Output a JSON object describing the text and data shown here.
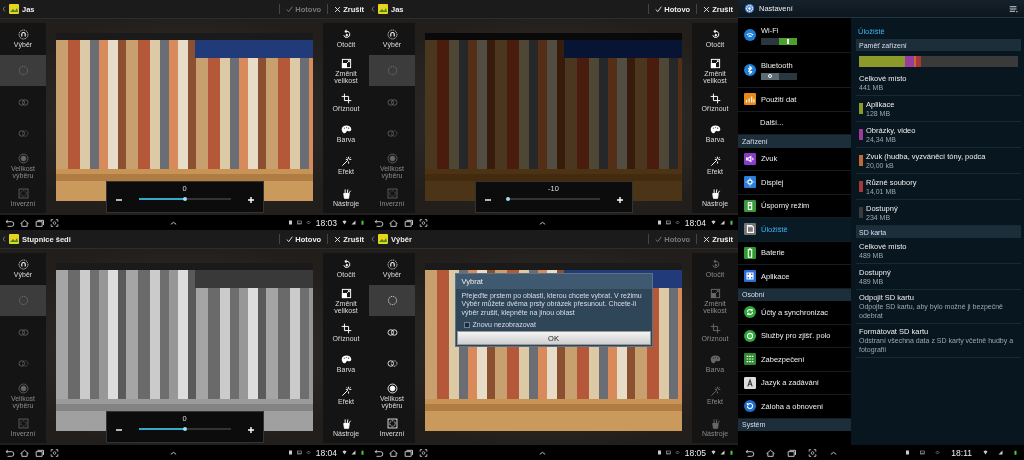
{
  "editors": [
    {
      "title": "Jas",
      "done": "Hotovo",
      "done_enabled": false,
      "cancel": "Zrušit",
      "darkened": false,
      "grayscale": false,
      "slider": {
        "value": "0",
        "level": 0.5
      },
      "left_tools": [
        {
          "kind": "lasso",
          "label": "Výběr",
          "selected": false,
          "disabled": false
        },
        {
          "kind": "circle",
          "selected": true,
          "disabled": true
        },
        {
          "kind": "union",
          "selected": false,
          "disabled": true
        },
        {
          "kind": "intersect",
          "selected": false,
          "disabled": true
        },
        {
          "kind": "size",
          "label": "Velikost výběru",
          "selected": false,
          "disabled": true
        },
        {
          "kind": "invert",
          "label": "Inverzní",
          "selected": false,
          "disabled": true
        }
      ],
      "right_tools": [
        {
          "kind": "rotate",
          "label": "Otočit",
          "disabled": false
        },
        {
          "kind": "resize",
          "label": "Změnit velikost",
          "disabled": false
        },
        {
          "kind": "crop",
          "label": "Oříznout",
          "disabled": false
        },
        {
          "kind": "palette",
          "label": "Barva",
          "disabled": false
        },
        {
          "kind": "wand",
          "label": "Efekt",
          "disabled": false
        },
        {
          "kind": "tools",
          "label": "Nástroje",
          "disabled": false
        }
      ],
      "time": "18:03"
    },
    {
      "title": "Jas",
      "done": "Hotovo",
      "done_enabled": true,
      "cancel": "Zrušit",
      "darkened": true,
      "grayscale": false,
      "slider": {
        "value": "-10",
        "level": 0.0
      },
      "left_tools": [
        {
          "kind": "lasso",
          "label": "Výběr",
          "selected": false,
          "disabled": false
        },
        {
          "kind": "circle",
          "selected": true,
          "disabled": true
        },
        {
          "kind": "union",
          "selected": false,
          "disabled": true
        },
        {
          "kind": "intersect",
          "selected": false,
          "disabled": true
        },
        {
          "kind": "size",
          "label": "Velikost výběru",
          "selected": false,
          "disabled": true
        },
        {
          "kind": "invert",
          "label": "Inverzní",
          "selected": false,
          "disabled": true
        }
      ],
      "right_tools": [
        {
          "kind": "rotate",
          "label": "Otočit",
          "disabled": false
        },
        {
          "kind": "resize",
          "label": "Změnit velikost",
          "disabled": false
        },
        {
          "kind": "crop",
          "label": "Oříznout",
          "disabled": false
        },
        {
          "kind": "palette",
          "label": "Barva",
          "disabled": false
        },
        {
          "kind": "wand",
          "label": "Efekt",
          "disabled": false
        },
        {
          "kind": "tools",
          "label": "Nástroje",
          "disabled": false
        }
      ],
      "time": "18:04"
    },
    {
      "title": "Stupnice šedi",
      "done": "Hotovo",
      "done_enabled": true,
      "cancel": "Zrušit",
      "darkened": false,
      "grayscale": true,
      "slider": {
        "value": "0",
        "level": 0.5
      },
      "left_tools": [
        {
          "kind": "lasso",
          "label": "Výběr",
          "selected": false,
          "disabled": false
        },
        {
          "kind": "circle",
          "selected": true,
          "disabled": true
        },
        {
          "kind": "union",
          "selected": false,
          "disabled": true
        },
        {
          "kind": "intersect",
          "selected": false,
          "disabled": true
        },
        {
          "kind": "size",
          "label": "Velikost výběru",
          "selected": false,
          "disabled": true
        },
        {
          "kind": "invert",
          "label": "Inverzní",
          "selected": false,
          "disabled": true
        }
      ],
      "right_tools": [
        {
          "kind": "rotate",
          "label": "Otočit",
          "disabled": false
        },
        {
          "kind": "resize",
          "label": "Změnit velikost",
          "disabled": false
        },
        {
          "kind": "crop",
          "label": "Oříznout",
          "disabled": false
        },
        {
          "kind": "palette",
          "label": "Barva",
          "disabled": false
        },
        {
          "kind": "wand",
          "label": "Efekt",
          "disabled": false
        },
        {
          "kind": "tools",
          "label": "Nástroje",
          "disabled": false
        }
      ],
      "time": "18:04"
    },
    {
      "title": "Výběr",
      "done": "Hotovo",
      "done_enabled": false,
      "cancel": "Zrušit",
      "darkened": false,
      "grayscale": false,
      "dialog": {
        "title": "Vybrat",
        "message": "Přejeďte prstem po oblasti, kterou chcete vybrat. V režimu Výběr můžete dvěma prsty obrázek přesunout. Chcete-li výběr zrušit, klepněte na jinou oblast",
        "checkbox": "Znovu nezobrazovat",
        "checked": false,
        "button": "OK"
      },
      "left_tools": [
        {
          "kind": "lasso",
          "label": "Výběr",
          "selected": false,
          "disabled": false
        },
        {
          "kind": "circle",
          "selected": true,
          "disabled": false
        },
        {
          "kind": "union",
          "selected": false,
          "disabled": false
        },
        {
          "kind": "intersect",
          "selected": false,
          "disabled": false
        },
        {
          "kind": "size",
          "label": "Velikost výběru",
          "selected": false,
          "disabled": false
        },
        {
          "kind": "invert",
          "label": "Inverzní",
          "selected": false,
          "disabled": false
        }
      ],
      "right_tools": [
        {
          "kind": "rotate",
          "label": "Otočit",
          "disabled": true
        },
        {
          "kind": "resize",
          "label": "Změnit velikost",
          "disabled": true
        },
        {
          "kind": "crop",
          "label": "Oříznout",
          "disabled": true
        },
        {
          "kind": "palette",
          "label": "Barva",
          "disabled": true
        },
        {
          "kind": "wand",
          "label": "Efekt",
          "disabled": true
        },
        {
          "kind": "tools",
          "label": "Nástroje",
          "disabled": true
        }
      ],
      "time": "18:05"
    }
  ],
  "settings": {
    "title": "Nastavení",
    "time": "18:11",
    "menu": [
      {
        "kind": "toggle",
        "label": "Wi-Fi",
        "on": true
      },
      {
        "kind": "toggle",
        "label": "Bluetooth",
        "on": false
      },
      {
        "kind": "item",
        "label": "Použití dat",
        "selected": false
      },
      {
        "kind": "plain",
        "label": "Další...",
        "selected": false
      },
      {
        "kind": "section",
        "label": "Zařízení"
      },
      {
        "kind": "item",
        "label": "Zvuk",
        "selected": false
      },
      {
        "kind": "item",
        "label": "Displej",
        "selected": false
      },
      {
        "kind": "item",
        "label": "Úsporný režim",
        "selected": false
      },
      {
        "kind": "item",
        "label": "Úložiště",
        "selected": true
      },
      {
        "kind": "item",
        "label": "Baterie",
        "selected": false
      },
      {
        "kind": "item",
        "label": "Aplikace",
        "selected": false
      },
      {
        "kind": "section",
        "label": "Osobní"
      },
      {
        "kind": "item",
        "label": "Účty a synchronizac",
        "selected": false
      },
      {
        "kind": "item",
        "label": "Služby pro zjišť. polo",
        "selected": false
      },
      {
        "kind": "item",
        "label": "Zabezpečení",
        "selected": false
      },
      {
        "kind": "item",
        "label": "Jazyk a zadávání",
        "selected": false
      },
      {
        "kind": "item",
        "label": "Záloha a obnovení",
        "selected": false
      },
      {
        "kind": "section",
        "label": "Systém"
      }
    ],
    "storage": {
      "title": "Úložiště",
      "groups": [
        {
          "label": "Paměť zařízení",
          "rows": [
            {
              "kind": "total",
              "label": "Celkové místo",
              "value": "441 MB"
            },
            {
              "kind": "category",
              "label": "Aplikace",
              "value": "128 MB",
              "color": "#8c9a2c"
            },
            {
              "kind": "category",
              "label": "Obrázky, video",
              "value": "24,34 MB",
              "color": "#9a3c9e"
            },
            {
              "kind": "category",
              "label": "Zvuk (hudba, vyzváněcí tóny, podca",
              "value": "20,00 kB",
              "color": "#c06a36"
            },
            {
              "kind": "category",
              "label": "Různé soubory",
              "value": "14,01 MB",
              "color": "#a83838"
            },
            {
              "kind": "category",
              "label": "Dostupný",
              "value": "234 MB",
              "color": "#3a3a3a"
            }
          ]
        },
        {
          "label": "SD karta",
          "rows": [
            {
              "kind": "total",
              "label": "Celkové místo",
              "value": "489 MB"
            },
            {
              "kind": "total",
              "label": "Dostupný",
              "value": "489 MB"
            },
            {
              "kind": "action",
              "label": "Odpojit SD kartu",
              "description": "Odpojte SD kartu, aby bylo možné ji bezpečně odebrat"
            },
            {
              "kind": "action",
              "label": "Formátovat SD kartu",
              "description": "Odstraní všechna data z SD karty včetně hudby a fotografií"
            }
          ]
        }
      ]
    }
  }
}
